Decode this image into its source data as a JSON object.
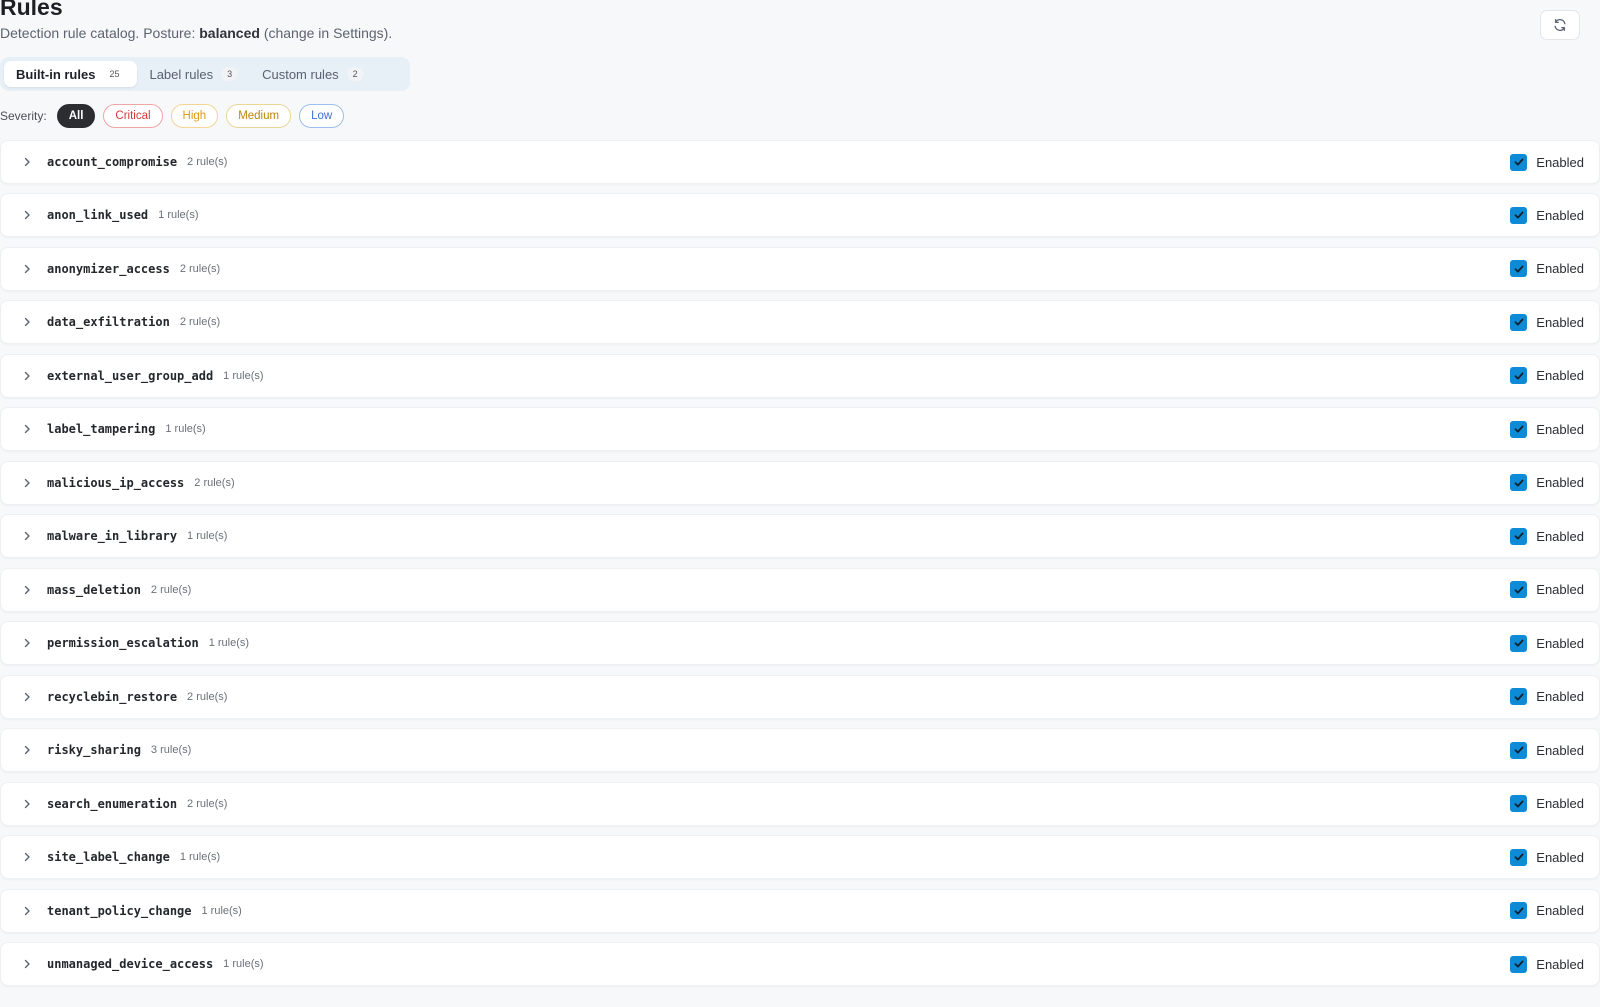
{
  "header": {
    "title": "Rules",
    "subtitle_prefix": "Detection rule catalog. Posture: ",
    "posture": "balanced",
    "subtitle_suffix": " (change in Settings)."
  },
  "tabs": [
    {
      "label": "Built-in rules",
      "count": "25",
      "active": true
    },
    {
      "label": "Label rules",
      "count": "3",
      "active": false
    },
    {
      "label": "Custom rules",
      "count": "2",
      "active": false
    }
  ],
  "severity": {
    "label": "Severity:",
    "options": [
      "All",
      "Critical",
      "High",
      "Medium",
      "Low"
    ],
    "selected": "All"
  },
  "rule_groups": [
    {
      "name": "account_compromise",
      "count": "2 rule(s)",
      "enabled": true,
      "enabled_label": "Enabled"
    },
    {
      "name": "anon_link_used",
      "count": "1 rule(s)",
      "enabled": true,
      "enabled_label": "Enabled"
    },
    {
      "name": "anonymizer_access",
      "count": "2 rule(s)",
      "enabled": true,
      "enabled_label": "Enabled"
    },
    {
      "name": "data_exfiltration",
      "count": "2 rule(s)",
      "enabled": true,
      "enabled_label": "Enabled"
    },
    {
      "name": "external_user_group_add",
      "count": "1 rule(s)",
      "enabled": true,
      "enabled_label": "Enabled"
    },
    {
      "name": "label_tampering",
      "count": "1 rule(s)",
      "enabled": true,
      "enabled_label": "Enabled"
    },
    {
      "name": "malicious_ip_access",
      "count": "2 rule(s)",
      "enabled": true,
      "enabled_label": "Enabled"
    },
    {
      "name": "malware_in_library",
      "count": "1 rule(s)",
      "enabled": true,
      "enabled_label": "Enabled"
    },
    {
      "name": "mass_deletion",
      "count": "2 rule(s)",
      "enabled": true,
      "enabled_label": "Enabled"
    },
    {
      "name": "permission_escalation",
      "count": "1 rule(s)",
      "enabled": true,
      "enabled_label": "Enabled"
    },
    {
      "name": "recyclebin_restore",
      "count": "2 rule(s)",
      "enabled": true,
      "enabled_label": "Enabled"
    },
    {
      "name": "risky_sharing",
      "count": "3 rule(s)",
      "enabled": true,
      "enabled_label": "Enabled"
    },
    {
      "name": "search_enumeration",
      "count": "2 rule(s)",
      "enabled": true,
      "enabled_label": "Enabled"
    },
    {
      "name": "site_label_change",
      "count": "1 rule(s)",
      "enabled": true,
      "enabled_label": "Enabled"
    },
    {
      "name": "tenant_policy_change",
      "count": "1 rule(s)",
      "enabled": true,
      "enabled_label": "Enabled"
    },
    {
      "name": "unmanaged_device_access",
      "count": "1 rule(s)",
      "enabled": true,
      "enabled_label": "Enabled"
    }
  ],
  "icons": {
    "refresh": "refresh-icon",
    "expand": "chevron-right-icon",
    "check": "check-icon"
  },
  "colors": {
    "checkbox": "#0e8bd6",
    "critical": "#d23b3b",
    "high": "#e09a12",
    "medium": "#b8860b",
    "low": "#3a72d1"
  }
}
